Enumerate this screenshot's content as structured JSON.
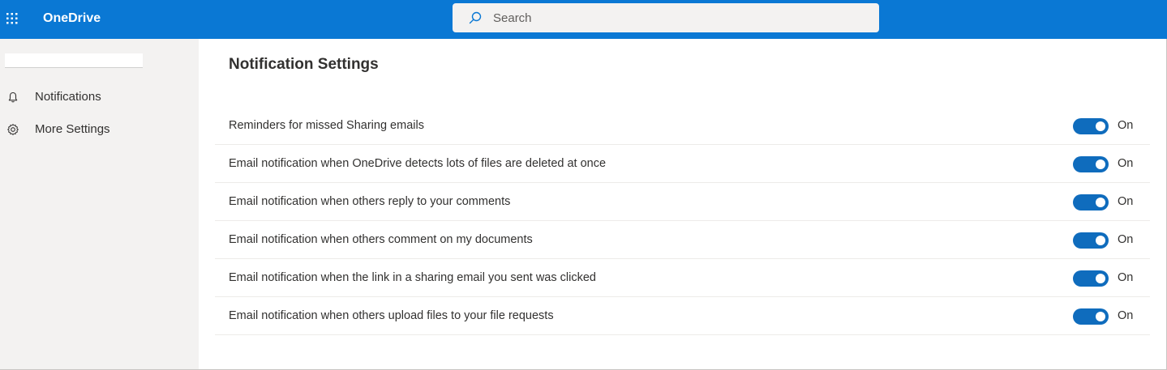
{
  "topbar": {
    "app_title": "OneDrive",
    "brand_color": "#0a78d4",
    "waffle_icon": "app-launcher-icon",
    "search": {
      "placeholder": "Search",
      "value": "",
      "icon": "search-icon"
    }
  },
  "sidebar": {
    "items": [
      {
        "label": "Notifications",
        "icon": "bell-icon"
      },
      {
        "label": "More Settings",
        "icon": "gear-icon"
      }
    ]
  },
  "main": {
    "title": "Notification Settings",
    "toggle_color": "#0f6cbd",
    "settings": [
      {
        "label": "Reminders for missed Sharing emails",
        "state": "On",
        "on": true
      },
      {
        "label": "Email notification when OneDrive detects lots of files are deleted at once",
        "state": "On",
        "on": true
      },
      {
        "label": "Email notification when others reply to your comments",
        "state": "On",
        "on": true
      },
      {
        "label": "Email notification when others comment on my documents",
        "state": "On",
        "on": true
      },
      {
        "label": "Email notification when the link in a sharing email you sent was clicked",
        "state": "On",
        "on": true
      },
      {
        "label": "Email notification when others upload files to your file requests",
        "state": "On",
        "on": true
      }
    ]
  }
}
